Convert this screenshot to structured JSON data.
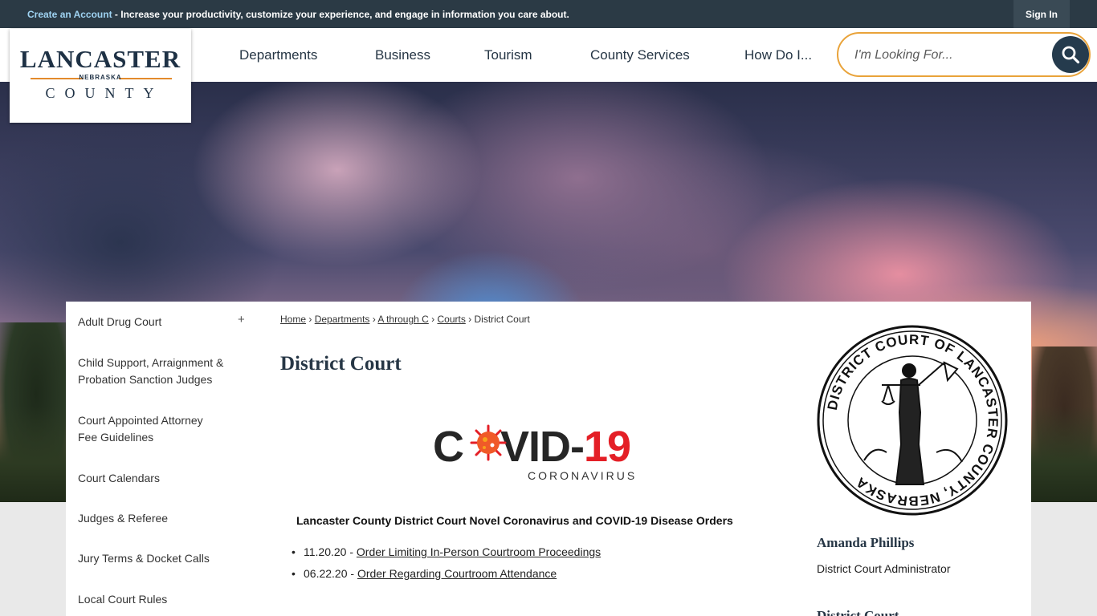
{
  "topbar": {
    "create_account": "Create an Account",
    "message": " - Increase your productivity, customize your experience, and engage in information you care about.",
    "sign_in": "Sign In"
  },
  "logo": {
    "name": "LANCASTER",
    "state": "NEBRASKA",
    "county": "COUNTY"
  },
  "nav": {
    "items": [
      "Departments",
      "Business",
      "Tourism",
      "County Services",
      "How Do I..."
    ]
  },
  "search": {
    "placeholder": "I'm Looking For..."
  },
  "sidebar": {
    "items": [
      {
        "label": "Adult Drug Court",
        "expand": "+"
      },
      {
        "label": "Child Support, Arraignment & Probation Sanction Judges"
      },
      {
        "label": "Court Appointed Attorney Fee Guidelines"
      },
      {
        "label": "Court Calendars"
      },
      {
        "label": "Judges & Referee"
      },
      {
        "label": "Jury Terms & Docket Calls"
      },
      {
        "label": "Local Court Rules"
      }
    ]
  },
  "breadcrumb": {
    "items": [
      "Home",
      "Departments",
      "A through C",
      "Courts"
    ],
    "separator": "›",
    "current": "District Court"
  },
  "page": {
    "title": "District Court",
    "covid_logo": {
      "part1": "C",
      "part2": "VID-",
      "part3": "19",
      "sub": "CORONAVIRUS"
    },
    "orders_title": "Lancaster County District Court Novel Coronavirus and COVID-19 Disease Orders",
    "orders": [
      {
        "date": "11.20.20 - ",
        "link": "Order Limiting In-Person Courtroom Proceedings"
      },
      {
        "date": "06.22.20 - ",
        "link": "Order Regarding Courtroom Attendance"
      }
    ]
  },
  "seal": {
    "text": "DISTRICT COURT OF LANCASTER COUNTY, NEBRASKA"
  },
  "contact": {
    "name": "Amanda Phillips",
    "role": "District Court Administrator",
    "next_heading": "District Court"
  },
  "colors": {
    "topbar": "#2b3a45",
    "accent": "#e9a33a",
    "navy": "#253b4d",
    "covid_red": "#e41f26"
  }
}
